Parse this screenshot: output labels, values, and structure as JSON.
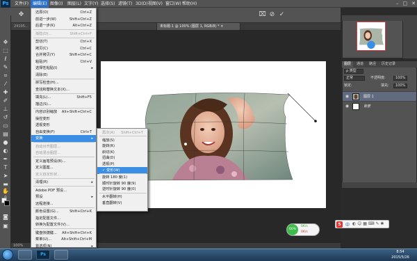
{
  "app": {
    "logo": "Ps"
  },
  "menubar": {
    "items": [
      "文件(F)",
      "编辑(E)",
      "图像(I)",
      "图层(L)",
      "文字(Y)",
      "选择(S)",
      "滤镜(T)",
      "3D(D)",
      "视图(V)",
      "窗口(W)",
      "帮助(H)"
    ],
    "active_index": 1
  },
  "doc_tabs": [
    {
      "label": "24195..."
    },
    {
      "label": "...",
      "active": false
    },
    {
      "label": "未标题-1 @ 100% (图层 1, RGB/8) * ×",
      "active": true
    }
  ],
  "edit_menu": {
    "items": [
      {
        "label": "还原(O)",
        "shortcut": "Ctrl+Z"
      },
      {
        "label": "前进一步(W)",
        "shortcut": "Shift+Ctrl+Z"
      },
      {
        "label": "后退一步(K)",
        "shortcut": "Alt+Ctrl+Z"
      },
      {
        "label": "渐隐(D)...",
        "shortcut": "Shift+Ctrl+F",
        "disabled": true
      },
      {
        "label": "剪切(T)",
        "shortcut": "Ctrl+X"
      },
      {
        "label": "拷贝(C)",
        "shortcut": "Ctrl+C"
      },
      {
        "label": "合并拷贝(Y)",
        "shortcut": "Shift+Ctrl+C"
      },
      {
        "label": "粘贴(P)",
        "shortcut": "Ctrl+V"
      },
      {
        "label": "选择性粘贴(I)",
        "arrow": true
      },
      {
        "label": "清除(E)"
      },
      {
        "label": "拼写检查(H)..."
      },
      {
        "label": "查找和替换文本(X)..."
      },
      {
        "label": "填充(L)...",
        "shortcut": "Shift+F5"
      },
      {
        "label": "描边(S)..."
      },
      {
        "label": "内容识别缩放",
        "shortcut": "Alt+Shift+Ctrl+C"
      },
      {
        "label": "操控变形"
      },
      {
        "label": "透视变形"
      },
      {
        "label": "自由变换(F)",
        "shortcut": "Ctrl+T"
      },
      {
        "label": "变换",
        "arrow": true,
        "highlighted": true
      },
      {
        "label": "自动对齐图层...",
        "disabled": true
      },
      {
        "label": "自动混合图层...",
        "disabled": true
      },
      {
        "label": "定义画笔预设(B)..."
      },
      {
        "label": "定义图案..."
      },
      {
        "label": "定义自定形状...",
        "disabled": true
      },
      {
        "label": "清理(R)",
        "arrow": true
      },
      {
        "label": "Adobe PDF 预设..."
      },
      {
        "label": "预设",
        "arrow": true
      },
      {
        "label": "远程连接..."
      },
      {
        "label": "颜色设置(G)...",
        "shortcut": "Shift+Ctrl+K"
      },
      {
        "label": "指定配置文件..."
      },
      {
        "label": "转换为配置文件(V)..."
      },
      {
        "label": "键盘快捷键...",
        "shortcut": "Alt+Shift+Ctrl+K"
      },
      {
        "label": "菜单(U)...",
        "shortcut": "Alt+Shift+Ctrl+M"
      },
      {
        "label": "首选项(N)",
        "arrow": true
      },
      {
        "label": "同步设置(E)",
        "arrow": true
      }
    ]
  },
  "transform_menu": {
    "items": [
      {
        "label": "再次(A)",
        "shortcut": "Shift+Ctrl+T",
        "disabled": true
      },
      {
        "label": "缩放(S)"
      },
      {
        "label": "旋转(R)"
      },
      {
        "label": "斜切(K)"
      },
      {
        "label": "扭曲(D)"
      },
      {
        "label": "透视(P)"
      },
      {
        "label": "✓ 变形(W)",
        "highlighted": true
      },
      {
        "label": "旋转 180 度(1)"
      },
      {
        "label": "顺时针旋转 90 度(9)"
      },
      {
        "label": "逆时针旋转 90 度(0)"
      },
      {
        "label": "水平翻转(H)"
      },
      {
        "label": "垂直翻转(V)"
      }
    ]
  },
  "layers_panel": {
    "tabs": [
      "图层",
      "通道",
      "路径",
      "历史记录"
    ],
    "active_tab": 0,
    "kind_label": "ρ 类型",
    "blend_mode": "正常",
    "opacity_label": "不透明度:",
    "opacity_value": "100%",
    "lock_label": "锁定:",
    "fill_label": "填充:",
    "fill_value": "100%",
    "layers": [
      {
        "name": "图层 1",
        "selected": true
      },
      {
        "name": "背景",
        "selected": false
      }
    ]
  },
  "status": {
    "zoom": "100%"
  },
  "net_widget": {
    "percent": "60%",
    "up": "0K/s",
    "down": "0K/s"
  },
  "ime": {
    "logo": "S",
    "label": "中"
  },
  "clock": {
    "time": "8:54",
    "date": "2015/5/26"
  }
}
